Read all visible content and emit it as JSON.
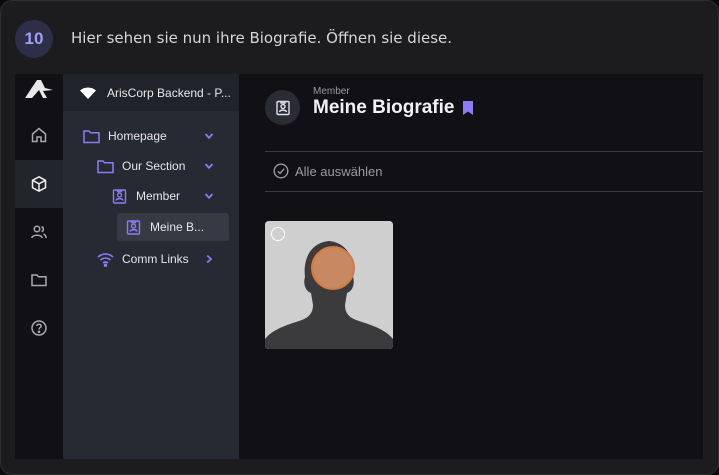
{
  "step": {
    "number": "10",
    "instruction": "Hier sehen sie nun ihre Biografie. Öffnen sie diese."
  },
  "tree": {
    "header_title": "ArisCorp Backend - P...",
    "nodes": [
      {
        "label": "Homepage",
        "icon": "folder-icon",
        "expanded": true
      },
      {
        "label": "Our Section",
        "icon": "folder-icon",
        "expanded": true
      },
      {
        "label": "Member",
        "icon": "badge-icon",
        "expanded": true
      },
      {
        "label": "Meine B...",
        "icon": "badge-icon",
        "selected": true
      },
      {
        "label": "Comm Links",
        "icon": "wifi-icon",
        "expanded": false
      }
    ]
  },
  "rail": {
    "items": [
      "home-icon",
      "cube-icon",
      "users-icon",
      "folder-icon",
      "help-icon"
    ],
    "active": "cube-icon"
  },
  "main": {
    "breadcrumb": "Member",
    "title": "Meine Biografie",
    "select_all": "Alle auswählen"
  },
  "colors": {
    "accent": "#8b7cf6",
    "badge_bg": "#2e2e48",
    "highlight": "#e29668"
  }
}
